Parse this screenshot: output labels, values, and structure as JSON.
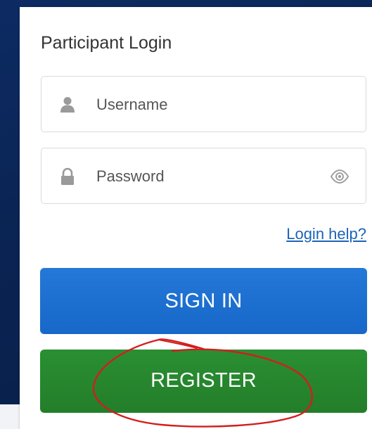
{
  "login": {
    "title": "Participant Login",
    "username_placeholder": "Username",
    "password_placeholder": "Password",
    "help_link": "Login help?",
    "signin_label": "SIGN IN",
    "register_label": "REGISTER"
  },
  "colors": {
    "primary": "#1f73d2",
    "register": "#268632",
    "link": "#1d63b8",
    "annotation": "#d21e1e"
  },
  "icons": {
    "username": "user-icon",
    "password": "lock-icon",
    "reveal": "eye-icon"
  }
}
